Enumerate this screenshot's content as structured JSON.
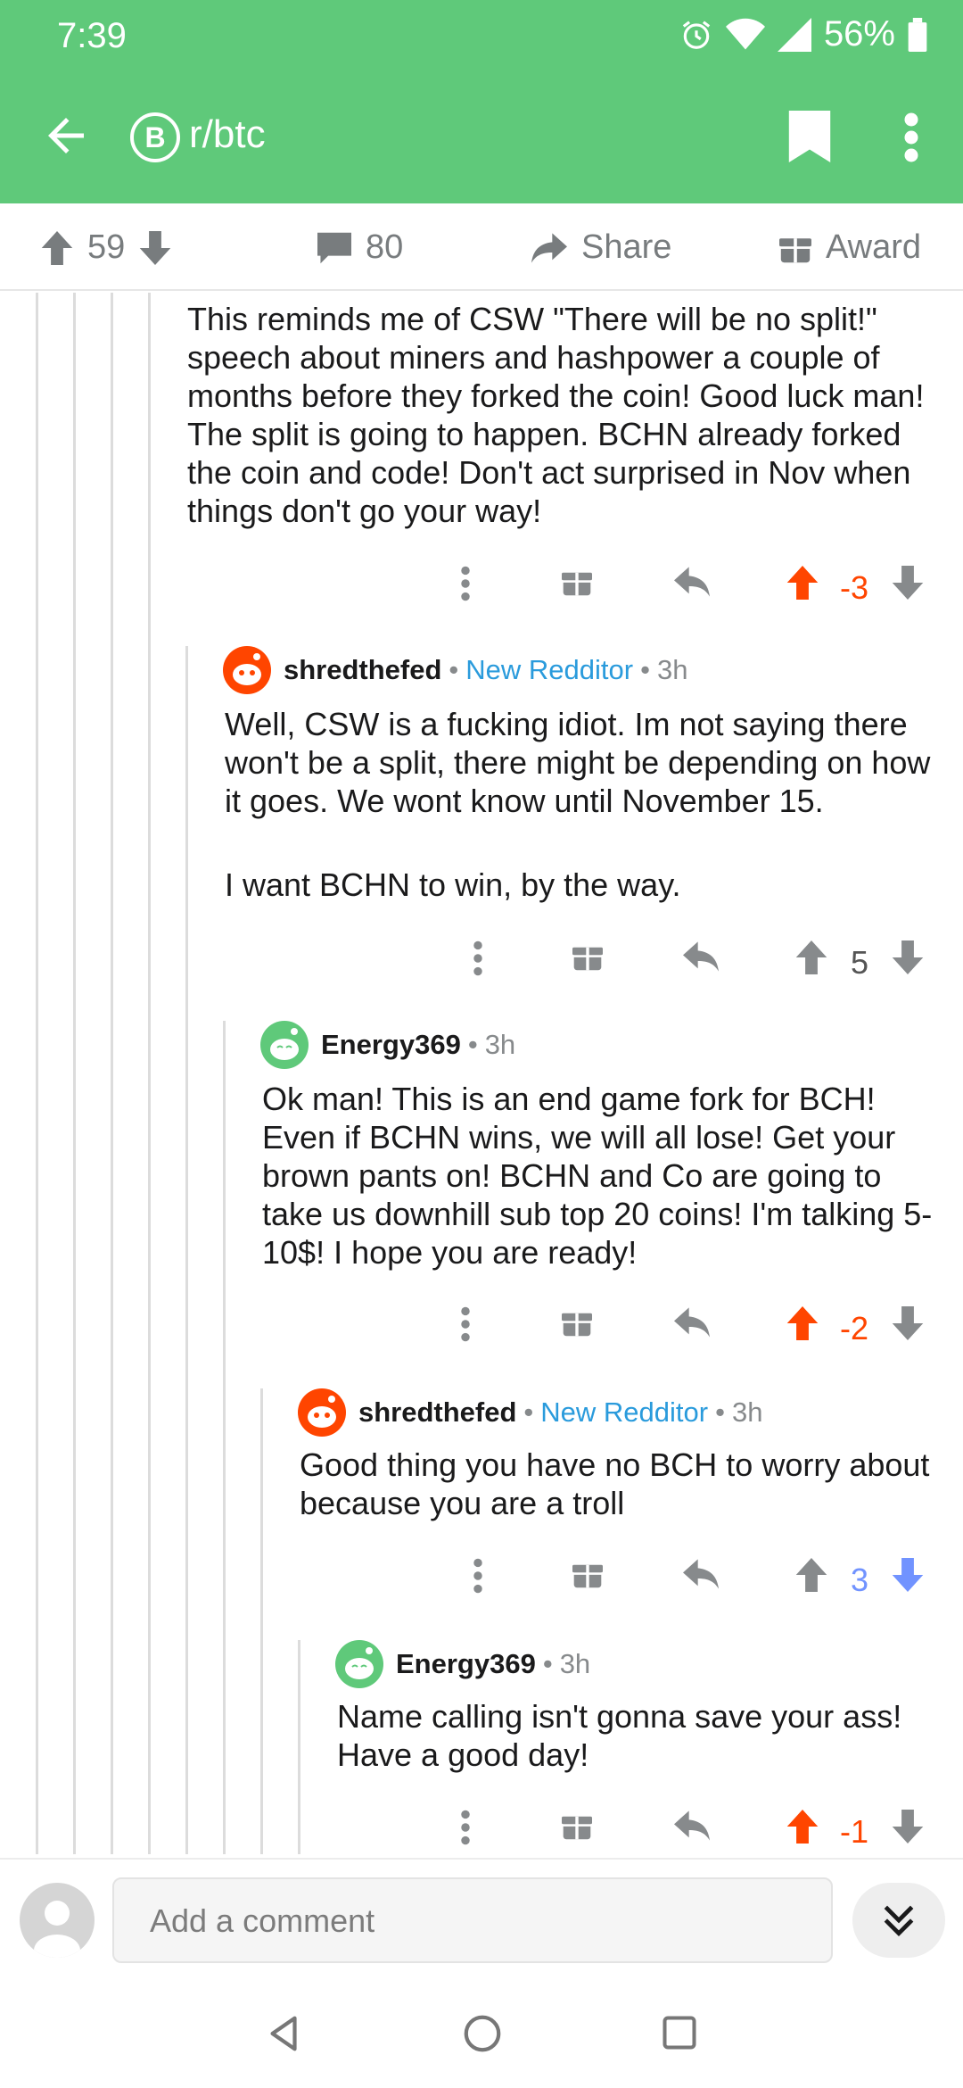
{
  "status_bar": {
    "time": "7:39",
    "battery": "56%"
  },
  "app_bar": {
    "subreddit": "r/btc",
    "sub_icon": "B"
  },
  "post_actions": {
    "upvotes": "59",
    "comments": "80",
    "share": "Share",
    "award": "Award"
  },
  "comments": [
    {
      "body": "This reminds me of CSW \"There will be no split!\" speech about miners and hashpower a couple of months before they forked the coin! Good luck man! The split is going to happen. BCHN already forked the coin and code! Don't act surprised in Nov when things don't go your way!",
      "score": "-3",
      "vote": "up"
    },
    {
      "user": "shredthefed",
      "flair": "New Redditor",
      "age": "3h",
      "body": "Well, CSW is a fucking idiot. Im not saying there won't be  a split, there might be depending on how it goes. We wont know until November 15.",
      "body2": "I want BCHN to win, by the way.",
      "score": "5",
      "vote": "none"
    },
    {
      "user": "Energy369",
      "age": "3h",
      "body": "Ok man! This is an end game fork for BCH! Even if BCHN wins, we will all lose! Get your brown pants on! BCHN and Co are going to take us downhill sub top 20 coins! I'm talking 5-10$! I hope you are ready!",
      "score": "-2",
      "vote": "up"
    },
    {
      "user": "shredthefed",
      "flair": "New Redditor",
      "age": "3h",
      "body": "Good thing you have no BCH to worry about because you are a troll",
      "score": "3",
      "vote": "down"
    },
    {
      "user": "Energy369",
      "age": "3h",
      "body": "Name calling isn't gonna save your ass! Have a good day!",
      "score": "-1",
      "vote": "up"
    }
  ],
  "composer": {
    "placeholder": "Add a comment"
  },
  "colors": {
    "brand_green": "#5fc97a",
    "upvote_orange": "#ff4500",
    "downvote_blue": "#7193ff",
    "flair_blue": "#2a9bdc"
  }
}
